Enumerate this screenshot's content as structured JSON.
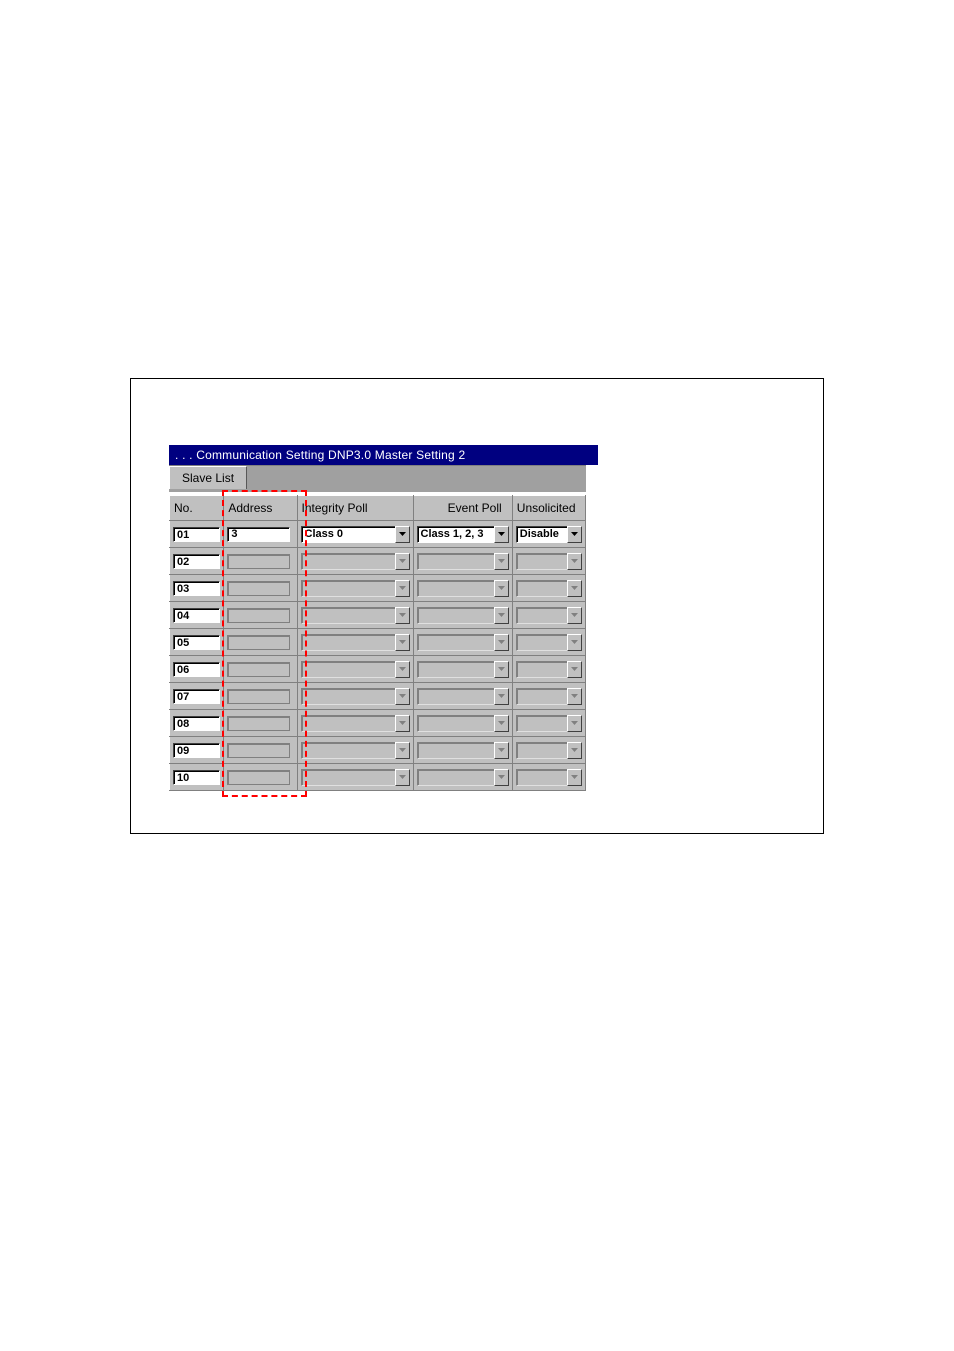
{
  "title_bar": ". . .  Communication Setting    DNP3.0 Master Setting 2",
  "tab_label": "Slave List",
  "headers": {
    "no": "No.",
    "address": "Address",
    "integrity": "Integrity Poll",
    "event": "Event Poll",
    "unsolicited": "Unsolicited"
  },
  "rows": [
    {
      "no": "01",
      "address": "3",
      "integrity": "Class 0",
      "event": "Class 1, 2, 3",
      "unsolicited": "Disable",
      "enabled": true
    },
    {
      "no": "02",
      "address": "",
      "integrity": "",
      "event": "",
      "unsolicited": "",
      "enabled": false
    },
    {
      "no": "03",
      "address": "",
      "integrity": "",
      "event": "",
      "unsolicited": "",
      "enabled": false
    },
    {
      "no": "04",
      "address": "",
      "integrity": "",
      "event": "",
      "unsolicited": "",
      "enabled": false
    },
    {
      "no": "05",
      "address": "",
      "integrity": "",
      "event": "",
      "unsolicited": "",
      "enabled": false
    },
    {
      "no": "06",
      "address": "",
      "integrity": "",
      "event": "",
      "unsolicited": "",
      "enabled": false
    },
    {
      "no": "07",
      "address": "",
      "integrity": "",
      "event": "",
      "unsolicited": "",
      "enabled": false
    },
    {
      "no": "08",
      "address": "",
      "integrity": "",
      "event": "",
      "unsolicited": "",
      "enabled": false
    },
    {
      "no": "09",
      "address": "",
      "integrity": "",
      "event": "",
      "unsolicited": "",
      "enabled": false
    },
    {
      "no": "10",
      "address": "",
      "integrity": "",
      "event": "",
      "unsolicited": "",
      "enabled": false
    }
  ]
}
